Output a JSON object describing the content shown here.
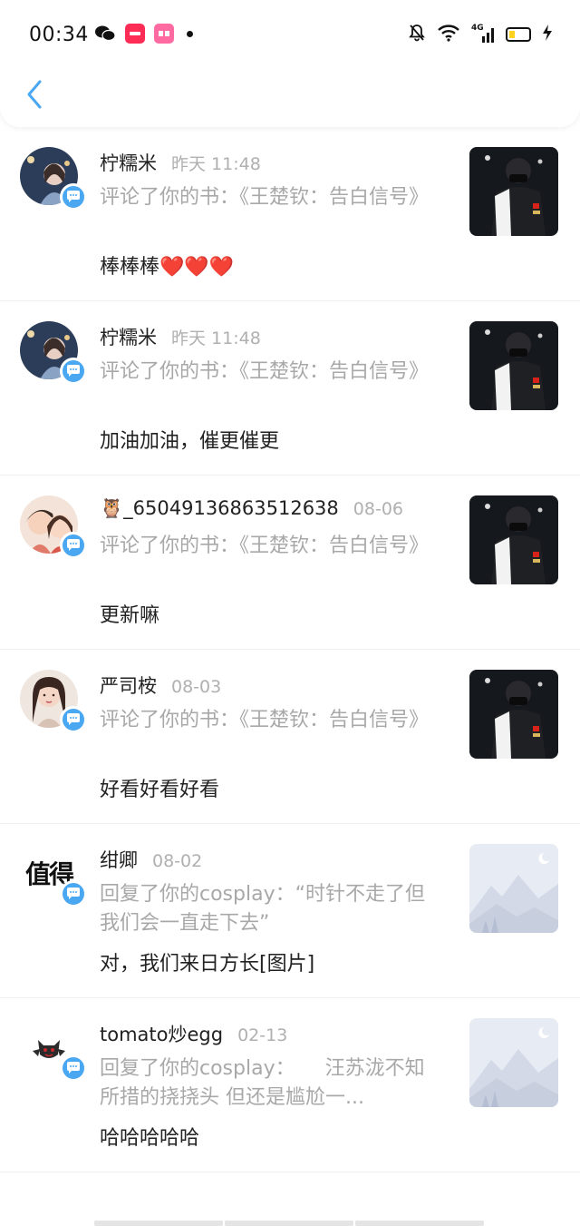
{
  "status_bar": {
    "time": "00:34",
    "signal_label": "4G",
    "app_icons": [
      "wechat-icon",
      "xiaohongshu-icon",
      "app-pink-icon"
    ]
  },
  "header": {
    "back_icon": "chevron-left-icon"
  },
  "colors": {
    "accent": "#4aa7f2",
    "muted_text": "#a8a8a8",
    "heart": "#e0242c"
  },
  "notifications": [
    {
      "name": "柠糯米",
      "time": "昨天 11:48",
      "action": "评论了你的书：《王楚钦：告白信号》",
      "comment": "棒棒棒",
      "hearts": "❤️❤️❤️"
    },
    {
      "name": "柠糯米",
      "time": "昨天 11:48",
      "action": "评论了你的书：《王楚钦：告白信号》",
      "comment": "加油加油，催更催更"
    },
    {
      "name": "🦉_65049136863512638",
      "time": "08-06",
      "action": "评论了你的书：《王楚钦：告白信号》",
      "comment": "更新嘛"
    },
    {
      "name": "严司桉",
      "time": "08-03",
      "action": "评论了你的书：《王楚钦：告白信号》",
      "comment": "好看好看好看"
    },
    {
      "name": "绀卿",
      "time": "08-02",
      "avatar_text": "值得",
      "action": "回复了你的cosplay：“时针不走了但我们会一直走下去”",
      "comment": "对，我们来日方长[图片]"
    },
    {
      "name": "tomato炒egg",
      "time": "02-13",
      "action": "回复了你的cosplay：　　汪苏泷不知所措的挠挠头 但还是尴尬一...",
      "comment": "哈哈哈哈哈"
    }
  ]
}
